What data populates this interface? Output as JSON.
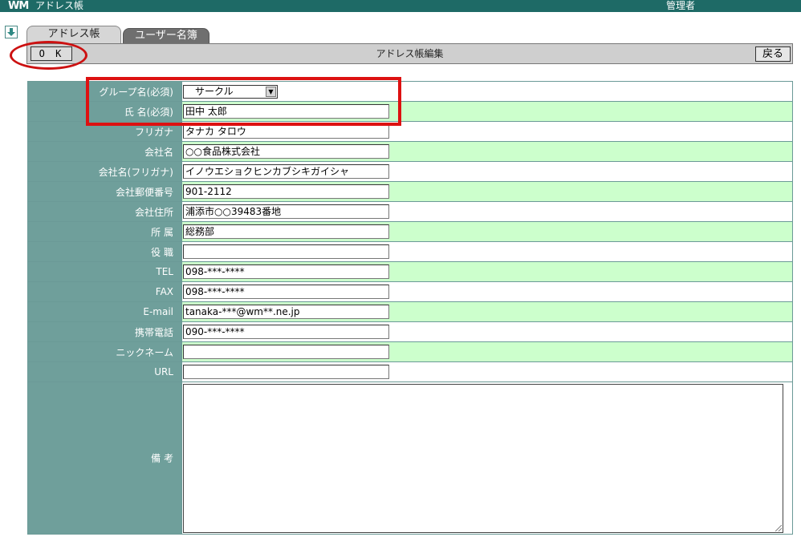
{
  "app": {
    "logo": "WM",
    "title": "アドレス帳",
    "user": "管理者"
  },
  "tabs": [
    {
      "label": "アドレス帳",
      "active": true
    },
    {
      "label": "ユーザー名簿",
      "active": false
    }
  ],
  "toolbar": {
    "ok_label": "O K",
    "title": "アドレス帳編集",
    "back_label": "戻る"
  },
  "icons": {
    "nav": "down-arrow-icon"
  },
  "colors": {
    "header": "#1e6a66",
    "label_bg": "#6f9f9b",
    "alt_row": "#ccffcc",
    "highlight": "#dd1111"
  },
  "form": {
    "group": {
      "label": "グループ名(必須)",
      "value": "サークル"
    },
    "fields": [
      {
        "label": "氏 名(必須)",
        "value": "田中 太郎"
      },
      {
        "label": "フリガナ",
        "value": "タナカ タロウ"
      },
      {
        "label": "会社名",
        "value": "○○食品株式会社"
      },
      {
        "label": "会社名(フリガナ)",
        "value": "イノウエショクヒンカブシキガイシャ"
      },
      {
        "label": "会社郵便番号",
        "value": "901-2112"
      },
      {
        "label": "会社住所",
        "value": "浦添市○○39483番地"
      },
      {
        "label": "所 属",
        "value": "総務部"
      },
      {
        "label": "役 職",
        "value": ""
      },
      {
        "label": "TEL",
        "value": "098-***-****"
      },
      {
        "label": "FAX",
        "value": "098-***-****"
      },
      {
        "label": "E-mail",
        "value": "tanaka-***@wm**.ne.jp"
      },
      {
        "label": "携帯電話",
        "value": "090-***-****"
      },
      {
        "label": "ニックネーム",
        "value": ""
      },
      {
        "label": "URL",
        "value": ""
      }
    ],
    "notes": {
      "label": "備 考",
      "value": ""
    }
  }
}
